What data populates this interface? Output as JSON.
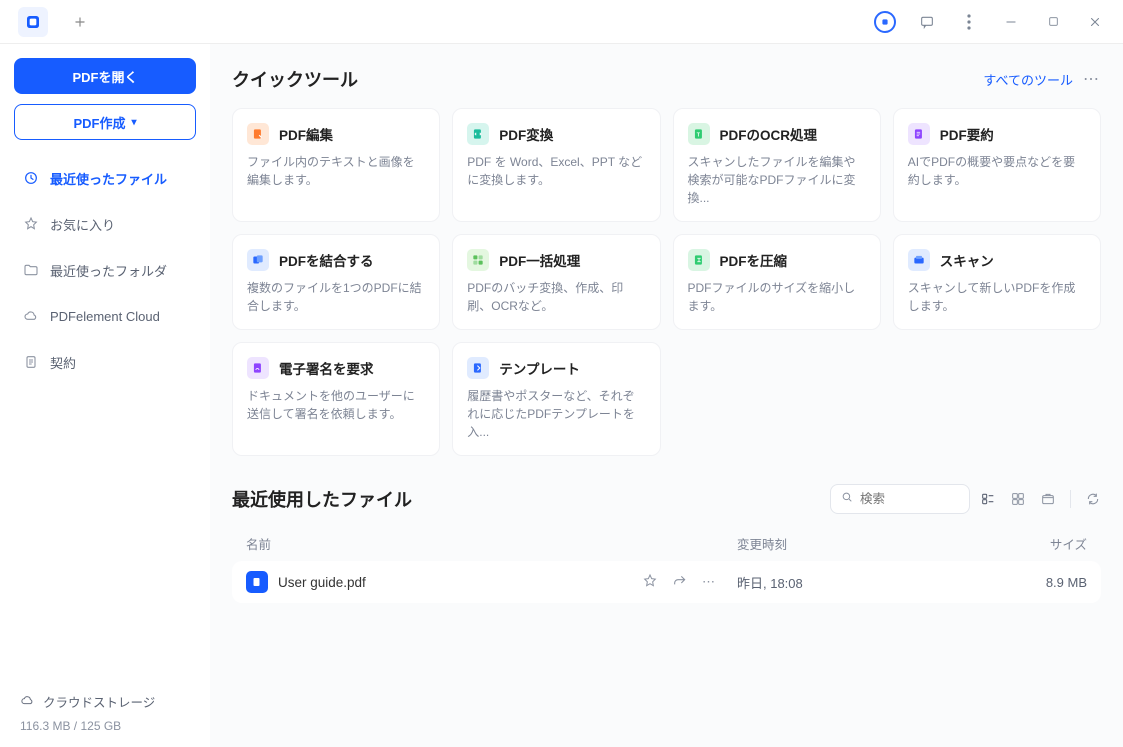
{
  "buttons": {
    "open_pdf": "PDFを開く",
    "create_pdf": "PDF作成"
  },
  "nav": {
    "recent": "最近使ったファイル",
    "favorites": "お気に入り",
    "recent_folders": "最近使ったフォルダ",
    "cloud": "PDFelement Cloud",
    "contract": "契約"
  },
  "quick": {
    "title": "クイックツール",
    "all_tools": "すべてのツール"
  },
  "tools": {
    "edit": {
      "title": "PDF編集",
      "desc": "ファイル内のテキストと画像を編集します。"
    },
    "convert": {
      "title": "PDF変換",
      "desc": "PDF を Word、Excel、PPT などに変換します。"
    },
    "ocr": {
      "title": "PDFのOCR処理",
      "desc": "スキャンしたファイルを編集や検索が可能なPDFファイルに変換..."
    },
    "summarize": {
      "title": "PDF要約",
      "desc": "AIでPDFの概要や要点などを要約します。"
    },
    "merge": {
      "title": "PDFを結合する",
      "desc": "複数のファイルを1つのPDFに結合します。"
    },
    "batch": {
      "title": "PDF一括処理",
      "desc": "PDFのバッチ変換、作成、印刷、OCRなど。"
    },
    "compress": {
      "title": "PDFを圧縮",
      "desc": "PDFファイルのサイズを縮小します。"
    },
    "scan": {
      "title": "スキャン",
      "desc": "スキャンして新しいPDFを作成します。"
    },
    "esign": {
      "title": "電子署名を要求",
      "desc": "ドキュメントを他のユーザーに送信して署名を依頼します。"
    },
    "template": {
      "title": "テンプレート",
      "desc": "履歴書やポスターなど、それぞれに応じたPDFテンプレートを入..."
    }
  },
  "recent": {
    "title": "最近使用したファイル",
    "search_placeholder": "検索",
    "cols": {
      "name": "名前",
      "time": "変更時刻",
      "size": "サイズ"
    },
    "files": {
      "0": {
        "name": "User guide.pdf",
        "time": "昨日, 18:08",
        "size": "8.9 MB"
      }
    }
  },
  "footer": {
    "cloud_storage": "クラウドストレージ",
    "usage": "116.3 MB / 125 GB"
  },
  "colors": {
    "accent": "#175cff",
    "orange": "#ff7b2e",
    "green_teal": "#1abc9c",
    "green": "#2ecc71",
    "purple": "#8e44ff",
    "blue": "#2a68ff"
  }
}
